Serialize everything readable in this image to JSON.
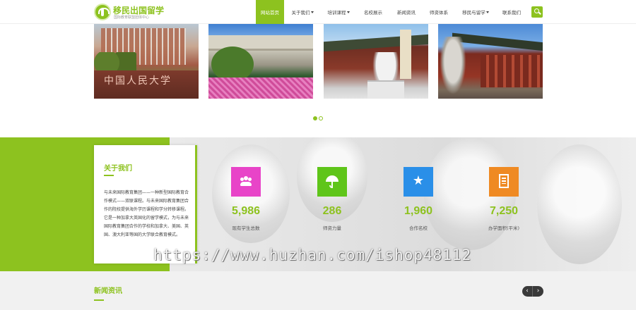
{
  "header": {
    "logo_title": "移民出国留学",
    "logo_subtitle": "国际教育联盟团体中心",
    "nav": [
      {
        "label": "网站首页",
        "active": true,
        "dropdown": false
      },
      {
        "label": "关于我们",
        "active": false,
        "dropdown": true
      },
      {
        "label": "培训课程",
        "active": false,
        "dropdown": true
      },
      {
        "label": "名校展示",
        "active": false,
        "dropdown": false
      },
      {
        "label": "新闻资讯",
        "active": false,
        "dropdown": false
      },
      {
        "label": "师资体系",
        "active": false,
        "dropdown": false
      },
      {
        "label": "移民与留学",
        "active": false,
        "dropdown": true
      },
      {
        "label": "联系我们",
        "active": false,
        "dropdown": false
      }
    ],
    "search_icon": "search-icon"
  },
  "slider": {
    "photo1_text": "中国人民大学",
    "active_dot": 0,
    "dot_count": 2
  },
  "about": {
    "title": "关于我们",
    "text": "与未来国际教育集团——一种新型国际教育合作模式——双联课程。与未来国际教育集团合作的院校提供海外学历课程和学分转移课程。它是一种加拿大英国化的留学模式，为与未来国际教育集团合作的学校和加拿大、美国、英国、澳大利亚等国的大学联合教育模式。"
  },
  "stats": [
    {
      "value": "5,986",
      "label": "现有学生总数",
      "color": "#e844c8",
      "icon": "users-icon"
    },
    {
      "value": "286",
      "label": "师资力量",
      "color": "#5fc51a",
      "icon": "umbrella-icon"
    },
    {
      "value": "1,960",
      "label": "合作名校",
      "color": "#2a8fe8",
      "icon": "star-icon"
    },
    {
      "value": "7,250",
      "label": "办学面积(平米)",
      "color": "#ef8a23",
      "icon": "building-icon"
    }
  ],
  "watermark": "https://www.huzhan.com/ishop48112",
  "news": {
    "title": "新闻资讯",
    "prev": "‹",
    "next": "›"
  },
  "colors": {
    "accent": "#8dc21f"
  }
}
